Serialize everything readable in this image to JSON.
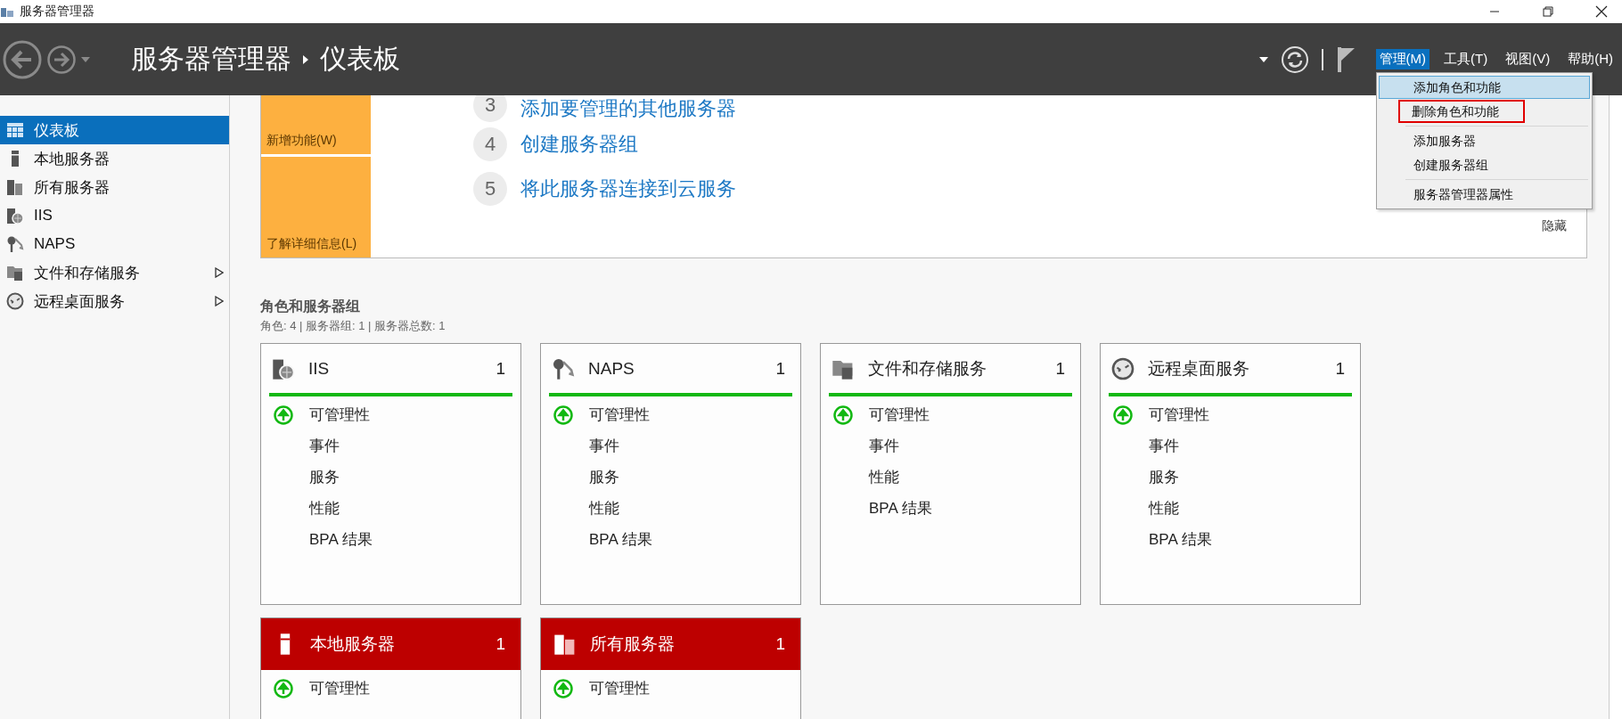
{
  "window": {
    "title": "服务器管理器"
  },
  "header": {
    "breadcrumb": [
      "服务器管理器",
      "仪表板"
    ],
    "menus": [
      {
        "label": "管理(M)",
        "selected": true
      },
      {
        "label": "工具(T)",
        "selected": false
      },
      {
        "label": "视图(V)",
        "selected": false
      },
      {
        "label": "帮助(H)",
        "selected": false
      }
    ],
    "dropdown": {
      "groups": [
        [
          {
            "label": "添加角色和功能",
            "selected": true,
            "outlined": false
          },
          {
            "label": "删除角色和功能",
            "selected": false,
            "outlined": true
          }
        ],
        [
          {
            "label": "添加服务器",
            "selected": false,
            "outlined": false
          },
          {
            "label": "创建服务器组",
            "selected": false,
            "outlined": false
          }
        ],
        [
          {
            "label": "服务器管理器属性",
            "selected": false,
            "outlined": false
          }
        ]
      ]
    }
  },
  "sidebar": {
    "items": [
      {
        "label": "仪表板",
        "kind": "dashboard",
        "selected": true,
        "has_submenu": false
      },
      {
        "label": "本地服务器",
        "kind": "server",
        "selected": false,
        "has_submenu": false
      },
      {
        "label": "所有服务器",
        "kind": "servers",
        "selected": false,
        "has_submenu": false
      },
      {
        "label": "IIS",
        "kind": "iis",
        "selected": false,
        "has_submenu": false
      },
      {
        "label": "NAPS",
        "kind": "keys",
        "selected": false,
        "has_submenu": false
      },
      {
        "label": "文件和存储服务",
        "kind": "files",
        "selected": false,
        "has_submenu": true
      },
      {
        "label": "远程桌面服务",
        "kind": "remote",
        "selected": false,
        "has_submenu": true
      }
    ]
  },
  "quick_start": {
    "tiles": [
      "新增功能(W)",
      "了解详细信息(L)"
    ],
    "steps": [
      {
        "number": "3",
        "text": "添加要管理的其他服务器"
      },
      {
        "number": "4",
        "text": "创建服务器组"
      },
      {
        "number": "5",
        "text": "将此服务器连接到云服务"
      }
    ],
    "hide_link": "隐藏"
  },
  "roles": {
    "title": "角色和服务器组",
    "summary": "角色: 4 | 服务器组: 1 | 服务器总数: 1",
    "tiles": [
      {
        "title": "IIS",
        "count": "1",
        "kind": "iis",
        "alert": false,
        "rows": [
          {
            "label": "可管理性",
            "healthy": true
          },
          {
            "label": "事件",
            "healthy": false
          },
          {
            "label": "服务",
            "healthy": false
          },
          {
            "label": "性能",
            "healthy": false
          },
          {
            "label": "BPA 结果",
            "healthy": false
          }
        ]
      },
      {
        "title": "NAPS",
        "count": "1",
        "kind": "keys",
        "alert": false,
        "rows": [
          {
            "label": "可管理性",
            "healthy": true
          },
          {
            "label": "事件",
            "healthy": false
          },
          {
            "label": "服务",
            "healthy": false
          },
          {
            "label": "性能",
            "healthy": false
          },
          {
            "label": "BPA 结果",
            "healthy": false
          }
        ]
      },
      {
        "title": "文件和存储服务",
        "count": "1",
        "kind": "files",
        "alert": false,
        "rows": [
          {
            "label": "可管理性",
            "healthy": true
          },
          {
            "label": "事件",
            "healthy": false
          },
          {
            "label": "性能",
            "healthy": false
          },
          {
            "label": "BPA 结果",
            "healthy": false
          }
        ]
      },
      {
        "title": "远程桌面服务",
        "count": "1",
        "kind": "remote",
        "alert": false,
        "rows": [
          {
            "label": "可管理性",
            "healthy": true
          },
          {
            "label": "事件",
            "healthy": false
          },
          {
            "label": "服务",
            "healthy": false
          },
          {
            "label": "性能",
            "healthy": false
          },
          {
            "label": "BPA 结果",
            "healthy": false
          }
        ]
      },
      {
        "title": "本地服务器",
        "count": "1",
        "kind": "server",
        "alert": true,
        "rows": [
          {
            "label": "可管理性",
            "healthy": true
          }
        ]
      },
      {
        "title": "所有服务器",
        "count": "1",
        "kind": "servers",
        "alert": true,
        "rows": [
          {
            "label": "可管理性",
            "healthy": true
          }
        ]
      }
    ]
  }
}
